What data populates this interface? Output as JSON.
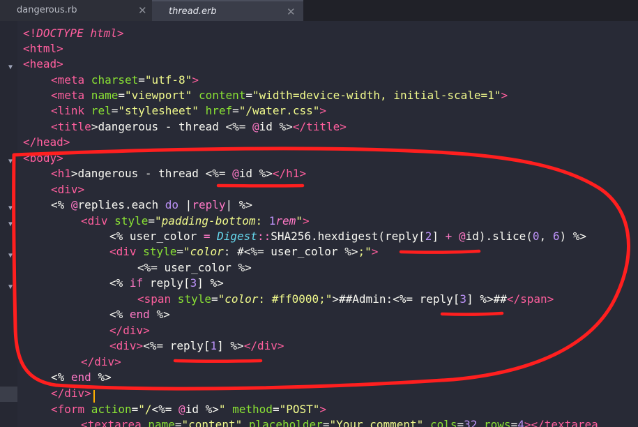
{
  "tabs": [
    {
      "label": "dangerous.rb",
      "close": "✕"
    },
    {
      "label": "thread.erb",
      "close": "✕"
    }
  ],
  "code": {
    "l1": [
      "<!",
      "DOCTYPE",
      " html",
      ">"
    ],
    "l2": [
      "<",
      "html",
      ">"
    ],
    "l3": [
      "<",
      "head",
      ">"
    ],
    "l4": [
      "<",
      "meta",
      " charset",
      "=",
      "\"utf-8\"",
      ">"
    ],
    "l5": [
      "<",
      "meta",
      " name",
      "=",
      "\"viewport\"",
      " content",
      "=",
      "\"width=device-width, initial-scale=1\"",
      ">"
    ],
    "l6": [
      "<",
      "link",
      " rel",
      "=",
      "\"stylesheet\"",
      " href",
      "=",
      "\"/water.css\"",
      ">"
    ],
    "l7": [
      "<",
      "title",
      ">dangerous - thread ",
      "<%= ",
      "@",
      "id",
      " %>",
      "</",
      "title",
      ">"
    ],
    "l8": [
      "</",
      "head",
      ">"
    ],
    "l9": [
      "<",
      "body",
      ">"
    ],
    "l10": [
      "<",
      "h1",
      ">dangerous - thread ",
      "<%= ",
      "@",
      "id",
      " %>",
      "</",
      "h1",
      ">"
    ],
    "l11": [
      "<",
      "div",
      ">"
    ],
    "l12": [
      "<% ",
      "@",
      "replies.each ",
      "do",
      " |",
      "reply",
      "| ",
      "%>"
    ],
    "l13": [
      "<",
      "div",
      " style",
      "=",
      "\"",
      "padding-bottom",
      ": ",
      "1",
      "rem",
      "\"",
      ">"
    ],
    "l14": [
      "<% ",
      "user_color ",
      "= ",
      "Digest",
      "::",
      "SHA256.hexdigest(",
      "reply[",
      "2",
      "] ",
      "+ ",
      "@",
      "id).slice(",
      "0",
      ", ",
      "6",
      ") ",
      "%>"
    ],
    "l15": [
      "<",
      "div",
      " style",
      "=",
      "\"",
      "color",
      ": #",
      "<%= ",
      "user_color ",
      "%>",
      ";\"",
      ">"
    ],
    "l16": [
      "<%= ",
      "user_color ",
      "%>"
    ],
    "l17": [
      "<% ",
      "if ",
      "reply[",
      "3",
      "] ",
      "%>"
    ],
    "l18": [
      "<",
      "span",
      " style",
      "=",
      "\"",
      "color",
      ": #ff0000;\"",
      ">##Admin:",
      "<%= ",
      "reply[",
      "3",
      "] ",
      "%>",
      "##",
      "</",
      "span",
      ">"
    ],
    "l19": [
      "<% ",
      "end ",
      "%>"
    ],
    "l20": [
      "</",
      "div",
      ">"
    ],
    "l21": [
      "<",
      "div",
      ">",
      "<%= ",
      "reply[",
      "1",
      "] ",
      "%>",
      "</",
      "div",
      ">"
    ],
    "l22": [
      "</",
      "div",
      ">"
    ],
    "l23": [
      "<% ",
      "end",
      " %>"
    ],
    "l24": [
      "</",
      "div",
      ">"
    ],
    "l25": [
      "<",
      "form",
      " action",
      "=",
      "\"/",
      "<%= ",
      "@",
      "id ",
      "%>",
      "\"",
      " method",
      "=",
      "\"POST\"",
      ">"
    ],
    "l26": [
      "<",
      "textarea",
      " name",
      "=",
      "\"content\"",
      " placeholder",
      "=",
      "\"Your comment\"",
      " cols",
      "=",
      "32",
      " rows",
      "=",
      "4",
      "></",
      "textarea"
    ]
  },
  "annotation_color": "#ff1f1f"
}
